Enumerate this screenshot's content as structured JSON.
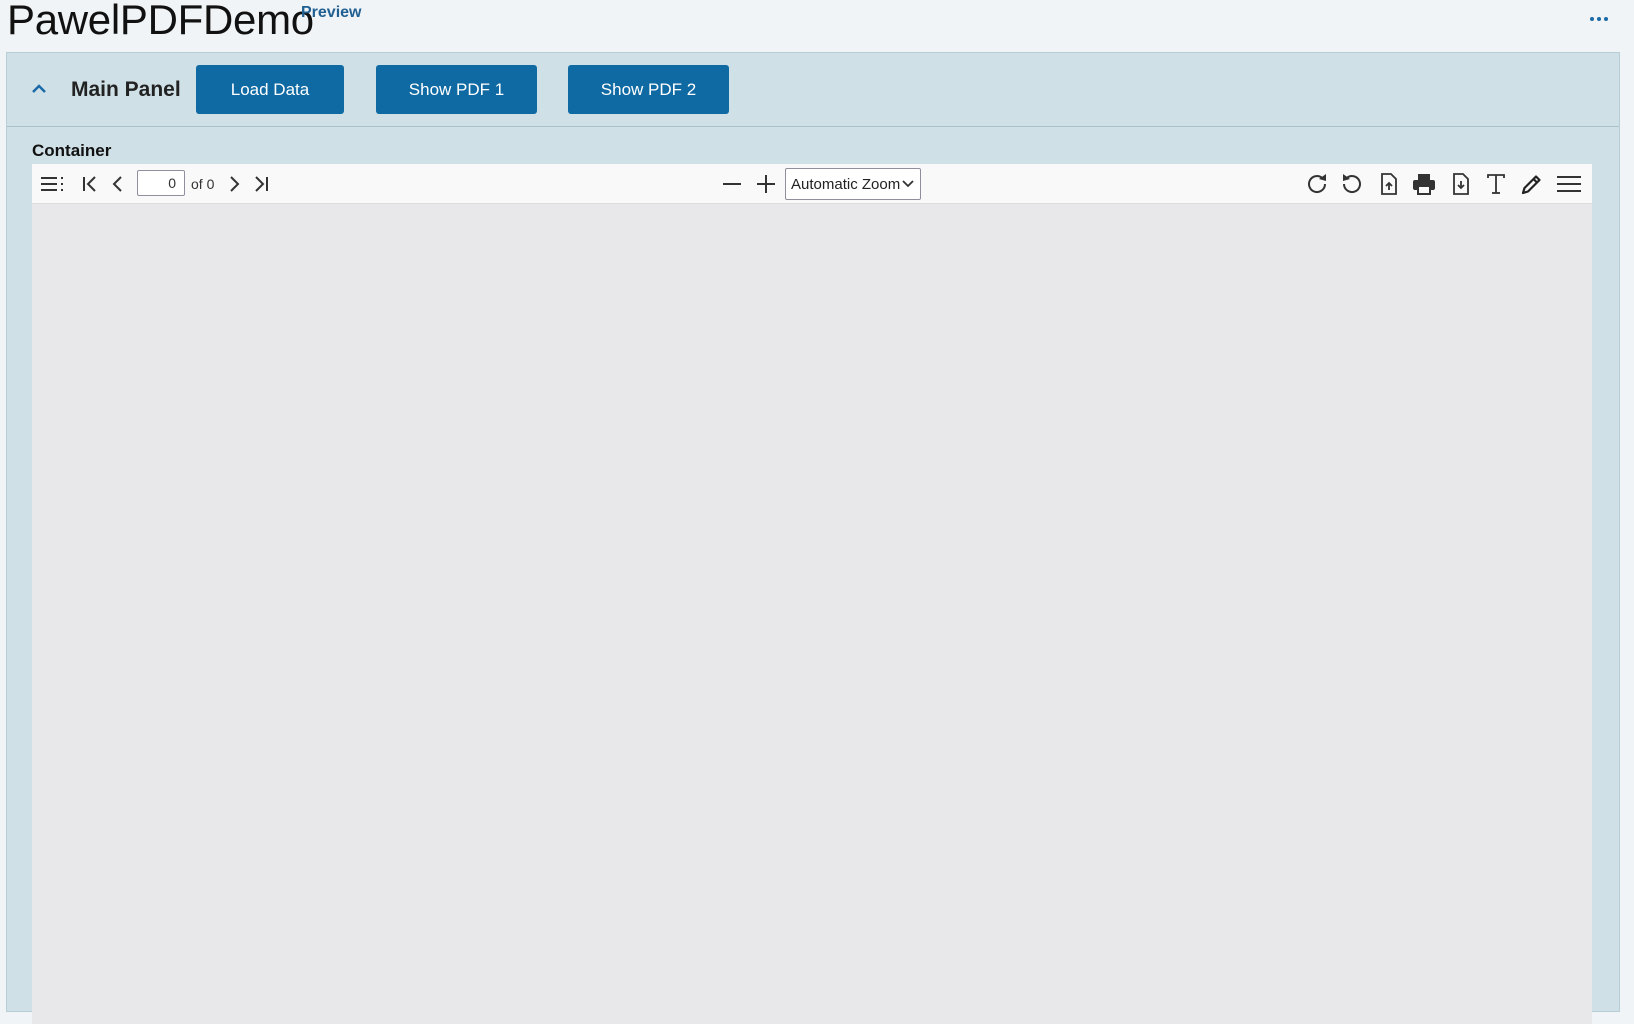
{
  "header": {
    "title": "PawelPDFDemo",
    "badge": "Preview",
    "more_icon": "ellipsis-icon"
  },
  "panel": {
    "title": "Main Panel",
    "collapse_icon": "chevron-up-icon",
    "buttons": {
      "load_data": "Load Data",
      "show_pdf_1": "Show PDF 1",
      "show_pdf_2": "Show PDF 2"
    },
    "accent_color": "#0f6aa3"
  },
  "container": {
    "label": "Container"
  },
  "pdf_viewer": {
    "page_value": "0",
    "page_count": "of 0",
    "zoom": "Automatic Zoom",
    "icons": [
      "sidebar-toggle-icon",
      "first-page-icon",
      "previous-page-icon",
      "next-page-icon",
      "last-page-icon",
      "zoom-out-icon",
      "zoom-in-icon",
      "rotate-clockwise-icon",
      "rotate-counterclockwise-icon",
      "open-file-icon",
      "print-icon",
      "download-icon",
      "text-tool-icon",
      "draw-tool-icon",
      "tools-menu-icon"
    ]
  }
}
